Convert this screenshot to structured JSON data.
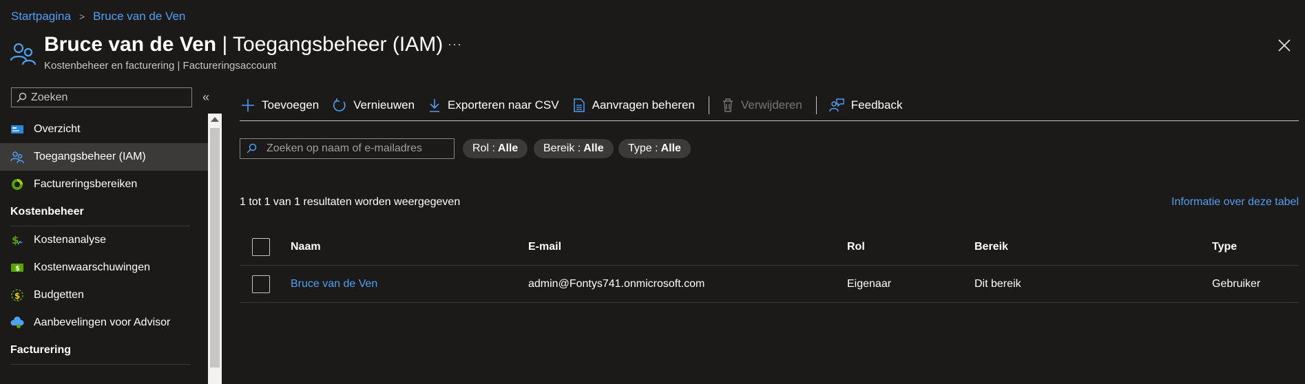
{
  "breadcrumb": {
    "home": "Startpagina",
    "current": "Bruce van de Ven"
  },
  "header": {
    "name": "Bruce van de Ven",
    "separator": " | ",
    "page": "Toegangsbeheer (IAM)",
    "subtitle": "Kostenbeheer en facturering | Factureringsaccount",
    "more": "···"
  },
  "sidebar": {
    "search_placeholder": "Zoeken",
    "collapse": "«",
    "items": [
      {
        "label": "Overzicht",
        "icon": "overview-icon"
      },
      {
        "label": "Toegangsbeheer (IAM)",
        "icon": "people-icon",
        "selected": true
      },
      {
        "label": "Factureringsbereiken",
        "icon": "billing-scope-icon"
      }
    ],
    "section_cost": "Kostenbeheer",
    "cost_items": [
      {
        "label": "Kostenanalyse",
        "icon": "cost-analysis-icon"
      },
      {
        "label": "Kostenwaarschuwingen",
        "icon": "cost-alert-icon"
      },
      {
        "label": "Budgetten",
        "icon": "budget-icon"
      },
      {
        "label": "Aanbevelingen voor Advisor",
        "icon": "advisor-icon"
      }
    ],
    "section_billing": "Facturering"
  },
  "toolbar": {
    "add": "Toevoegen",
    "refresh": "Vernieuwen",
    "export": "Exporteren naar CSV",
    "requests": "Aanvragen beheren",
    "delete": "Verwijderen",
    "feedback": "Feedback"
  },
  "filters": {
    "search_placeholder": "Zoeken op naam of e-mailadres",
    "role_label": "Rol : ",
    "role_value": "Alle",
    "scope_label": "Bereik : ",
    "scope_value": "Alle",
    "type_label": "Type : ",
    "type_value": "Alle"
  },
  "results": {
    "count_text": "1 tot 1 van 1 resultaten worden weergegeven",
    "info_link": "Informatie over deze tabel"
  },
  "table": {
    "headers": {
      "name": "Naam",
      "email": "E-mail",
      "role": "Rol",
      "scope": "Bereik",
      "type": "Type"
    },
    "rows": [
      {
        "name": "Bruce van de Ven",
        "email": "admin@Fontys741.onmicrosoft.com",
        "role": "Eigenaar",
        "scope": "Dit bereik",
        "type": "Gebruiker"
      }
    ]
  },
  "colors": {
    "accent": "#4ea0f5",
    "background": "#1b1a19",
    "selected": "#3b3a39"
  }
}
